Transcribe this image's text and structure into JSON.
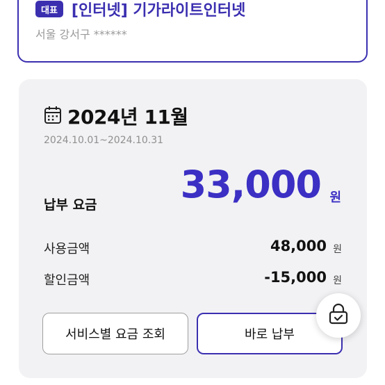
{
  "address_card": {
    "badge": "대표",
    "title": "[인터넷] 기가라이트인터넷",
    "location": "서울 강서구 ******"
  },
  "bill": {
    "period_title": "2024년 11월",
    "period_range": "2024.10.01~2024.10.31",
    "total_label": "납부 요금",
    "total_amount": "33,000",
    "total_unit": "원",
    "lines": [
      {
        "label": "사용금액",
        "value": "48,000",
        "unit": "원"
      },
      {
        "label": "할인금액",
        "value": "-15,000",
        "unit": "원"
      }
    ],
    "buttons": {
      "detail": "서비스별 요금 조회",
      "pay": "바로 납부"
    }
  },
  "icons": {
    "calendar": "calendar-icon",
    "lock": "lock-check-icon"
  },
  "colors": {
    "accent": "#3b2fb0",
    "amount": "#3b2fc4",
    "card_bg": "#f2f2f4"
  }
}
